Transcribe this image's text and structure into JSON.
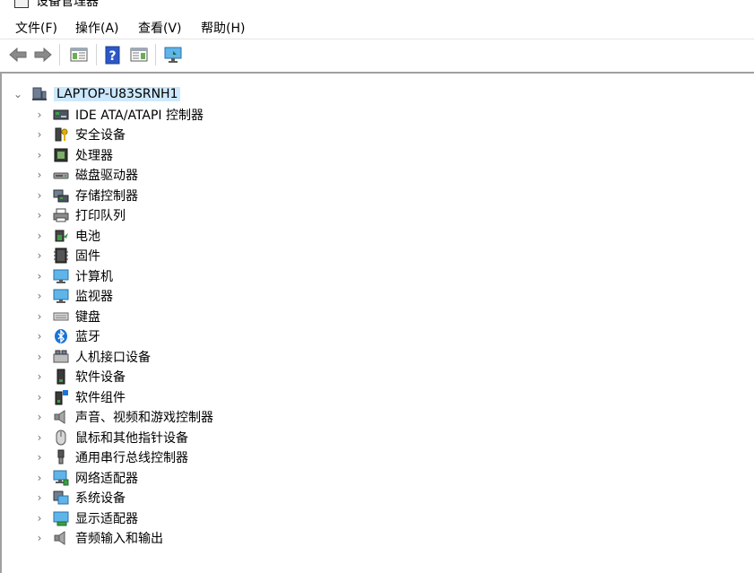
{
  "window": {
    "title": "设备管理器"
  },
  "menu": {
    "file": "文件(F)",
    "action": "操作(A)",
    "view": "查看(V)",
    "help": "帮助(H)"
  },
  "toolbar": {
    "buttons": [
      {
        "icon": "back-arrow-icon"
      },
      {
        "icon": "forward-arrow-icon"
      },
      {
        "icon": "show-hide-console-tree-icon"
      },
      {
        "icon": "help-icon"
      },
      {
        "icon": "properties-icon"
      },
      {
        "icon": "scan-hardware-monitor-icon"
      }
    ]
  },
  "tree": {
    "root": {
      "label": "LAPTOP-U83SRNH1",
      "expanded_glyph": "⌄"
    },
    "collapsed_glyph": "›",
    "items": [
      {
        "label": "IDE ATA/ATAPI 控制器",
        "icon": "ide-controller-icon"
      },
      {
        "label": "安全设备",
        "icon": "security-device-icon"
      },
      {
        "label": "处理器",
        "icon": "processor-icon"
      },
      {
        "label": "磁盘驱动器",
        "icon": "disk-drive-icon"
      },
      {
        "label": "存储控制器",
        "icon": "storage-controller-icon"
      },
      {
        "label": "打印队列",
        "icon": "printer-icon"
      },
      {
        "label": "电池",
        "icon": "battery-icon"
      },
      {
        "label": "固件",
        "icon": "firmware-icon"
      },
      {
        "label": "计算机",
        "icon": "computer-icon"
      },
      {
        "label": "监视器",
        "icon": "monitor-icon"
      },
      {
        "label": "键盘",
        "icon": "keyboard-icon"
      },
      {
        "label": "蓝牙",
        "icon": "bluetooth-icon"
      },
      {
        "label": "人机接口设备",
        "icon": "hid-icon"
      },
      {
        "label": "软件设备",
        "icon": "software-device-icon"
      },
      {
        "label": "软件组件",
        "icon": "software-component-icon"
      },
      {
        "label": "声音、视频和游戏控制器",
        "icon": "speaker-icon"
      },
      {
        "label": "鼠标和其他指针设备",
        "icon": "mouse-icon"
      },
      {
        "label": "通用串行总线控制器",
        "icon": "usb-icon"
      },
      {
        "label": "网络适配器",
        "icon": "network-adapter-icon"
      },
      {
        "label": "系统设备",
        "icon": "system-device-icon"
      },
      {
        "label": "显示适配器",
        "icon": "display-adapter-icon"
      },
      {
        "label": "音频输入和输出",
        "icon": "audio-io-icon"
      }
    ]
  },
  "colors": {
    "selection": "#cce8ff",
    "border": "#a0a0a0"
  }
}
